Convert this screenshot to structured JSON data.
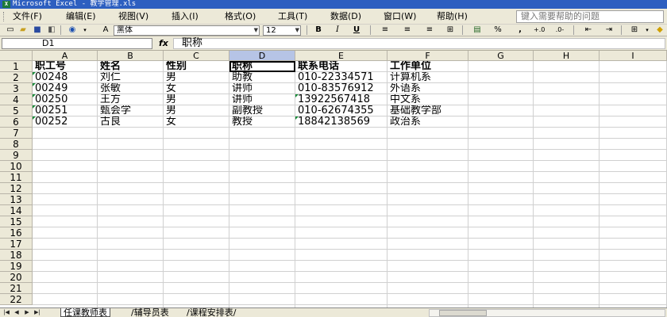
{
  "window": {
    "title": "Microsoft Excel - 教学管理.xls",
    "app_icon": "X"
  },
  "menubar": {
    "items": [
      "文件(F)",
      "编辑(E)",
      "视图(V)",
      "插入(I)",
      "格式(O)",
      "工具(T)",
      "数据(D)",
      "窗口(W)",
      "帮助(H)"
    ],
    "help_placeholder": "键入需要帮助的问题"
  },
  "toolbar": {
    "font_name": "黑体",
    "font_size": "12",
    "bold": "B",
    "italic": "I",
    "underline": "U",
    "percent": "%",
    "comma": ","
  },
  "formula_bar": {
    "name_box": "D1",
    "fx": "fx",
    "content": "职称"
  },
  "columns": [
    "A",
    "B",
    "C",
    "D",
    "E",
    "F",
    "G",
    "H",
    "I"
  ],
  "selected_column": "D",
  "rows": [
    "1",
    "2",
    "3",
    "4",
    "5",
    "6",
    "7",
    "8",
    "9",
    "10",
    "11",
    "12",
    "13",
    "14",
    "15",
    "16",
    "17",
    "18",
    "19",
    "20",
    "21",
    "22"
  ],
  "table": {
    "header": [
      "职工号",
      "姓名",
      "性别",
      "职称",
      "联系电话",
      "工作单位"
    ],
    "records": [
      [
        "00248",
        "刘仁",
        "男",
        "助教",
        "010-22334571",
        "计算机系"
      ],
      [
        "00249",
        "张敏",
        "女",
        "讲师",
        "010-83576912",
        "外语系"
      ],
      [
        "00250",
        "王方",
        "男",
        "讲师",
        "13922567418",
        "中文系"
      ],
      [
        "00251",
        "甄会学",
        "男",
        "副教授",
        "010-62674355",
        "基础教学部"
      ],
      [
        "00252",
        "古良",
        "女",
        "教授",
        "18842138569",
        "政治系"
      ]
    ]
  },
  "sheets": [
    "任课教师表",
    "辅导员表",
    "课程安排表"
  ],
  "active_sheet": 0
}
